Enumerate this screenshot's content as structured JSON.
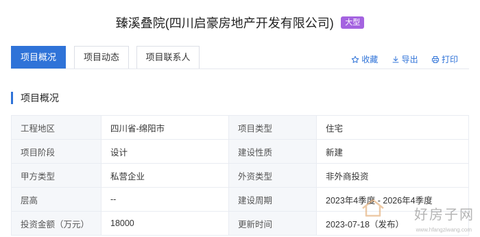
{
  "header": {
    "title": "臻溪叠院(四川启豪房地产开发有限公司)",
    "badge": "大型"
  },
  "tabs": [
    {
      "label": "项目概况",
      "active": true
    },
    {
      "label": "项目动态",
      "active": false
    },
    {
      "label": "项目联系人",
      "active": false
    }
  ],
  "actions": {
    "favorite": {
      "label": "收藏",
      "icon": "star-icon"
    },
    "export": {
      "label": "导出",
      "icon": "download-icon"
    },
    "print": {
      "label": "打印",
      "icon": "printer-icon"
    }
  },
  "section": {
    "title": "项目概况"
  },
  "info_rows": [
    [
      {
        "key": "工程地区",
        "value": "四川省-绵阳市"
      },
      {
        "key": "项目类型",
        "value": "住宅"
      }
    ],
    [
      {
        "key": "项目阶段",
        "value": "设计"
      },
      {
        "key": "建设性质",
        "value": "新建"
      }
    ],
    [
      {
        "key": "甲方类型",
        "value": "私营企业"
      },
      {
        "key": "外资类型",
        "value": "非外商投资"
      }
    ],
    [
      {
        "key": "层高",
        "value": "--"
      },
      {
        "key": "建设周期",
        "value": "2023年4季度 - 2026年4季度"
      }
    ],
    [
      {
        "key": "投资金额（万元）",
        "value": "18000"
      },
      {
        "key": "更新时间",
        "value": "2023-07-18（发布）"
      }
    ]
  ],
  "watermark": {
    "text": "好房子网",
    "url": "www.hfangziwang.com"
  },
  "colors": {
    "accent": "#2f73d8",
    "badge": "#a463e0"
  }
}
